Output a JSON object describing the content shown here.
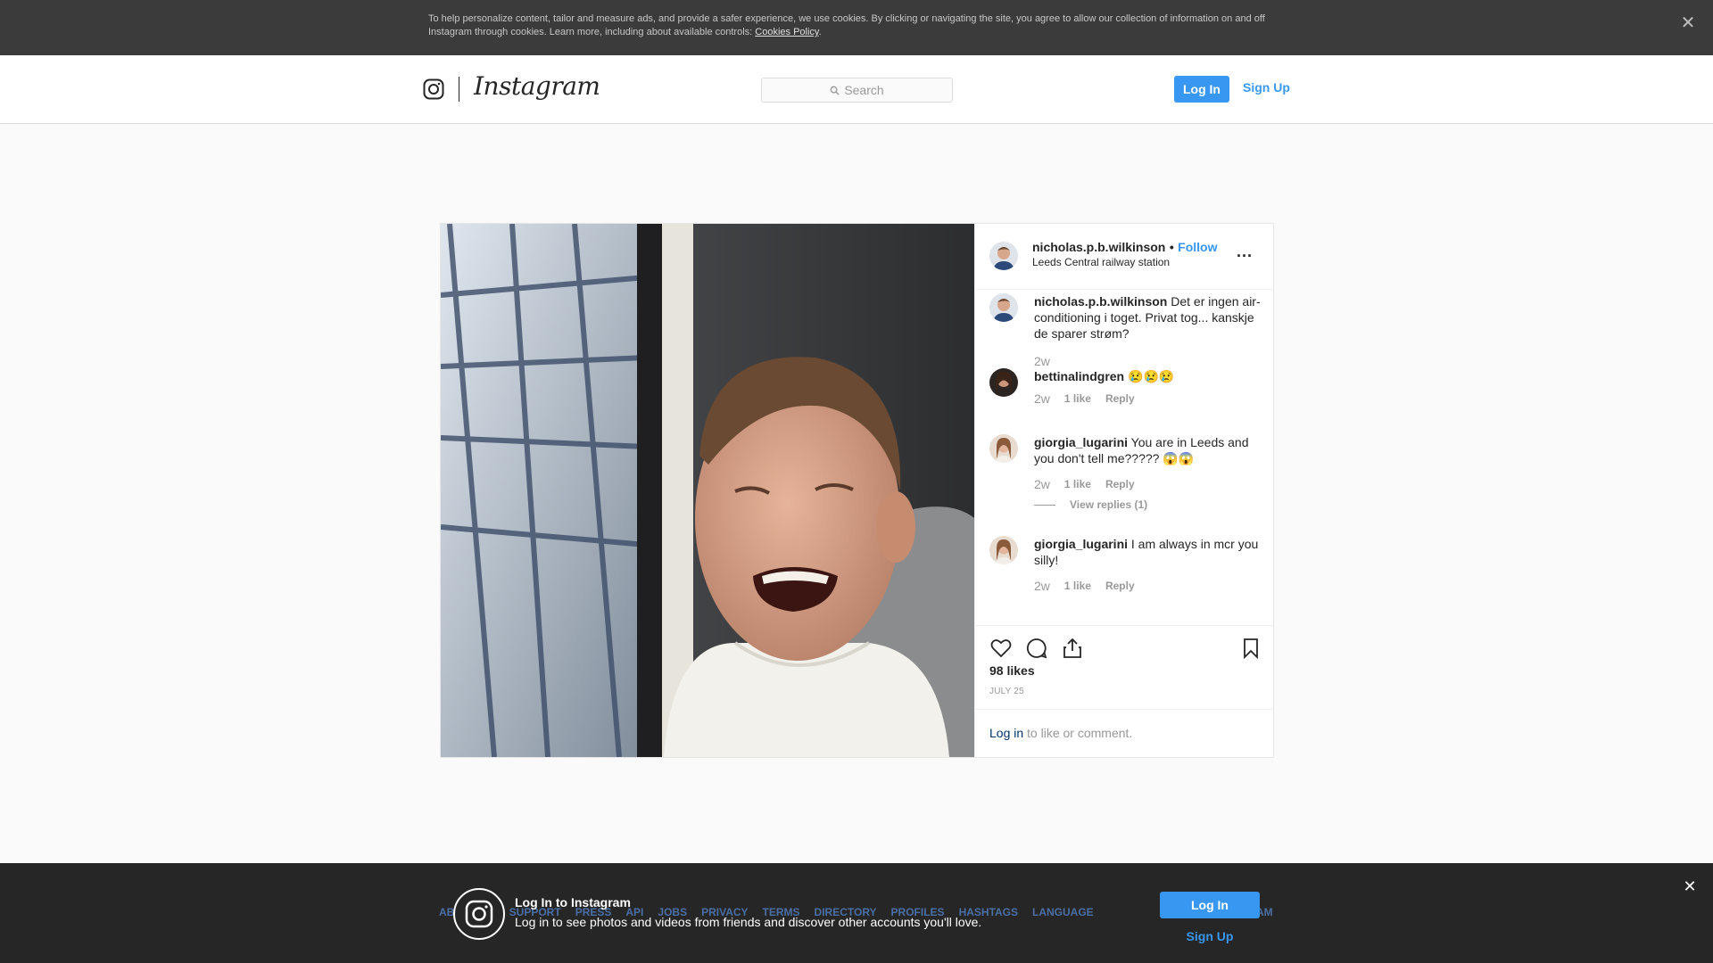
{
  "cookie_banner": {
    "text": "To help personalize content, tailor and measure ads, and provide a safer experience, we use cookies. By clicking or navigating the site, you agree to allow our collection of information on and off Instagram through cookies. Learn more, including about available controls: ",
    "link": "Cookies Policy",
    "trailing": ".",
    "close_icon": "close-icon"
  },
  "header": {
    "logo_text": "Instagram",
    "search_placeholder": "Search",
    "login_label": "Log In",
    "signup_label": "Sign Up"
  },
  "post": {
    "username": "nicholas.p.b.wilkinson",
    "separator": "•",
    "follow_label": "Follow",
    "location": "Leeds Central railway station",
    "more_label": "...",
    "comments": [
      {
        "user": "nicholas.p.b.wilkinson",
        "text": "Det er ingen air-conditioning i toget. Privat tog... kanskje de sparer strøm?",
        "time": "2w"
      },
      {
        "user": "bettinalindgren",
        "text": "😢😢😢",
        "time": "2w",
        "likes": "1 like",
        "reply": "Reply"
      },
      {
        "user": "giorgia_lugarini",
        "text": "You are in Leeds and you don't tell me????? 😱😱",
        "time": "2w",
        "likes": "1 like",
        "reply": "Reply",
        "view_replies": "View replies (1)"
      },
      {
        "user": "giorgia_lugarini",
        "text": "I am always in mcr you silly!",
        "time": "2w",
        "likes": "1 like",
        "reply": "Reply"
      }
    ],
    "likes": "98 likes",
    "date": "JULY 25",
    "login_link": "Log in",
    "login_suffix": " to like or comment."
  },
  "footer": {
    "links": [
      "ABOUT US",
      "SUPPORT",
      "PRESS",
      "API",
      "JOBS",
      "PRIVACY",
      "TERMS",
      "DIRECTORY",
      "PROFILES",
      "HASHTAGS",
      "LANGUAGE"
    ],
    "copyright": "AM"
  },
  "login_prompt": {
    "title": "Log In to Instagram",
    "subtitle": "Log in to see photos and videos from friends and discover other accounts you'll love.",
    "login_label": "Log In",
    "signup_label": "Sign Up"
  },
  "colors": {
    "accent": "#3897f0",
    "banner": "#3b3b3b",
    "footer": "#262626"
  }
}
